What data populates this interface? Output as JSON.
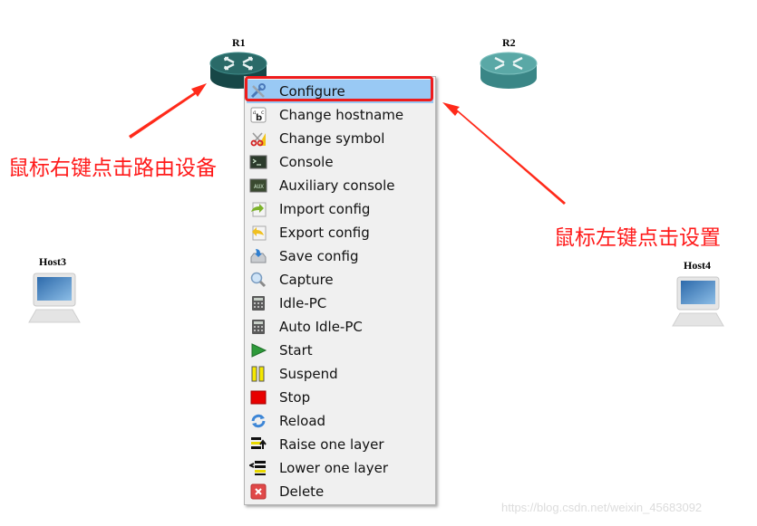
{
  "canvas": {
    "nodes": [
      {
        "id": "r1",
        "label": "R1",
        "type": "router",
        "state": "selected"
      },
      {
        "id": "r2",
        "label": "R2",
        "type": "router",
        "state": "normal"
      },
      {
        "id": "host3",
        "label": "Host3",
        "type": "host"
      },
      {
        "id": "host4",
        "label": "Host4",
        "type": "host"
      }
    ]
  },
  "context_menu": {
    "selected_index": 0,
    "items": [
      {
        "label": "Configure",
        "icon": "wrench-screwdriver-icon"
      },
      {
        "label": "Change hostname",
        "icon": "abc-text-icon"
      },
      {
        "label": "Change symbol",
        "icon": "scissors-icon"
      },
      {
        "label": "Console",
        "icon": "terminal-icon"
      },
      {
        "label": "Auxiliary console",
        "icon": "aux-terminal-icon"
      },
      {
        "label": "Import config",
        "icon": "import-icon"
      },
      {
        "label": "Export config",
        "icon": "export-icon"
      },
      {
        "label": "Save config",
        "icon": "save-drive-icon"
      },
      {
        "label": "Capture",
        "icon": "magnifier-icon"
      },
      {
        "label": "Idle-PC",
        "icon": "calculator-icon"
      },
      {
        "label": "Auto Idle-PC",
        "icon": "calculator-icon"
      },
      {
        "label": "Start",
        "icon": "play-icon"
      },
      {
        "label": "Suspend",
        "icon": "pause-icon"
      },
      {
        "label": "Stop",
        "icon": "stop-icon"
      },
      {
        "label": "Reload",
        "icon": "reload-icon"
      },
      {
        "label": "Raise one layer",
        "icon": "raise-layer-icon"
      },
      {
        "label": "Lower one layer",
        "icon": "lower-layer-icon"
      },
      {
        "label": "Delete",
        "icon": "delete-icon"
      }
    ]
  },
  "annotations": {
    "left": "鼠标右键点击路由设备",
    "right": "鼠标左键点击设置",
    "color": "#ff1a1a"
  },
  "watermark": "https://blog.csdn.net/weixin_45683092"
}
